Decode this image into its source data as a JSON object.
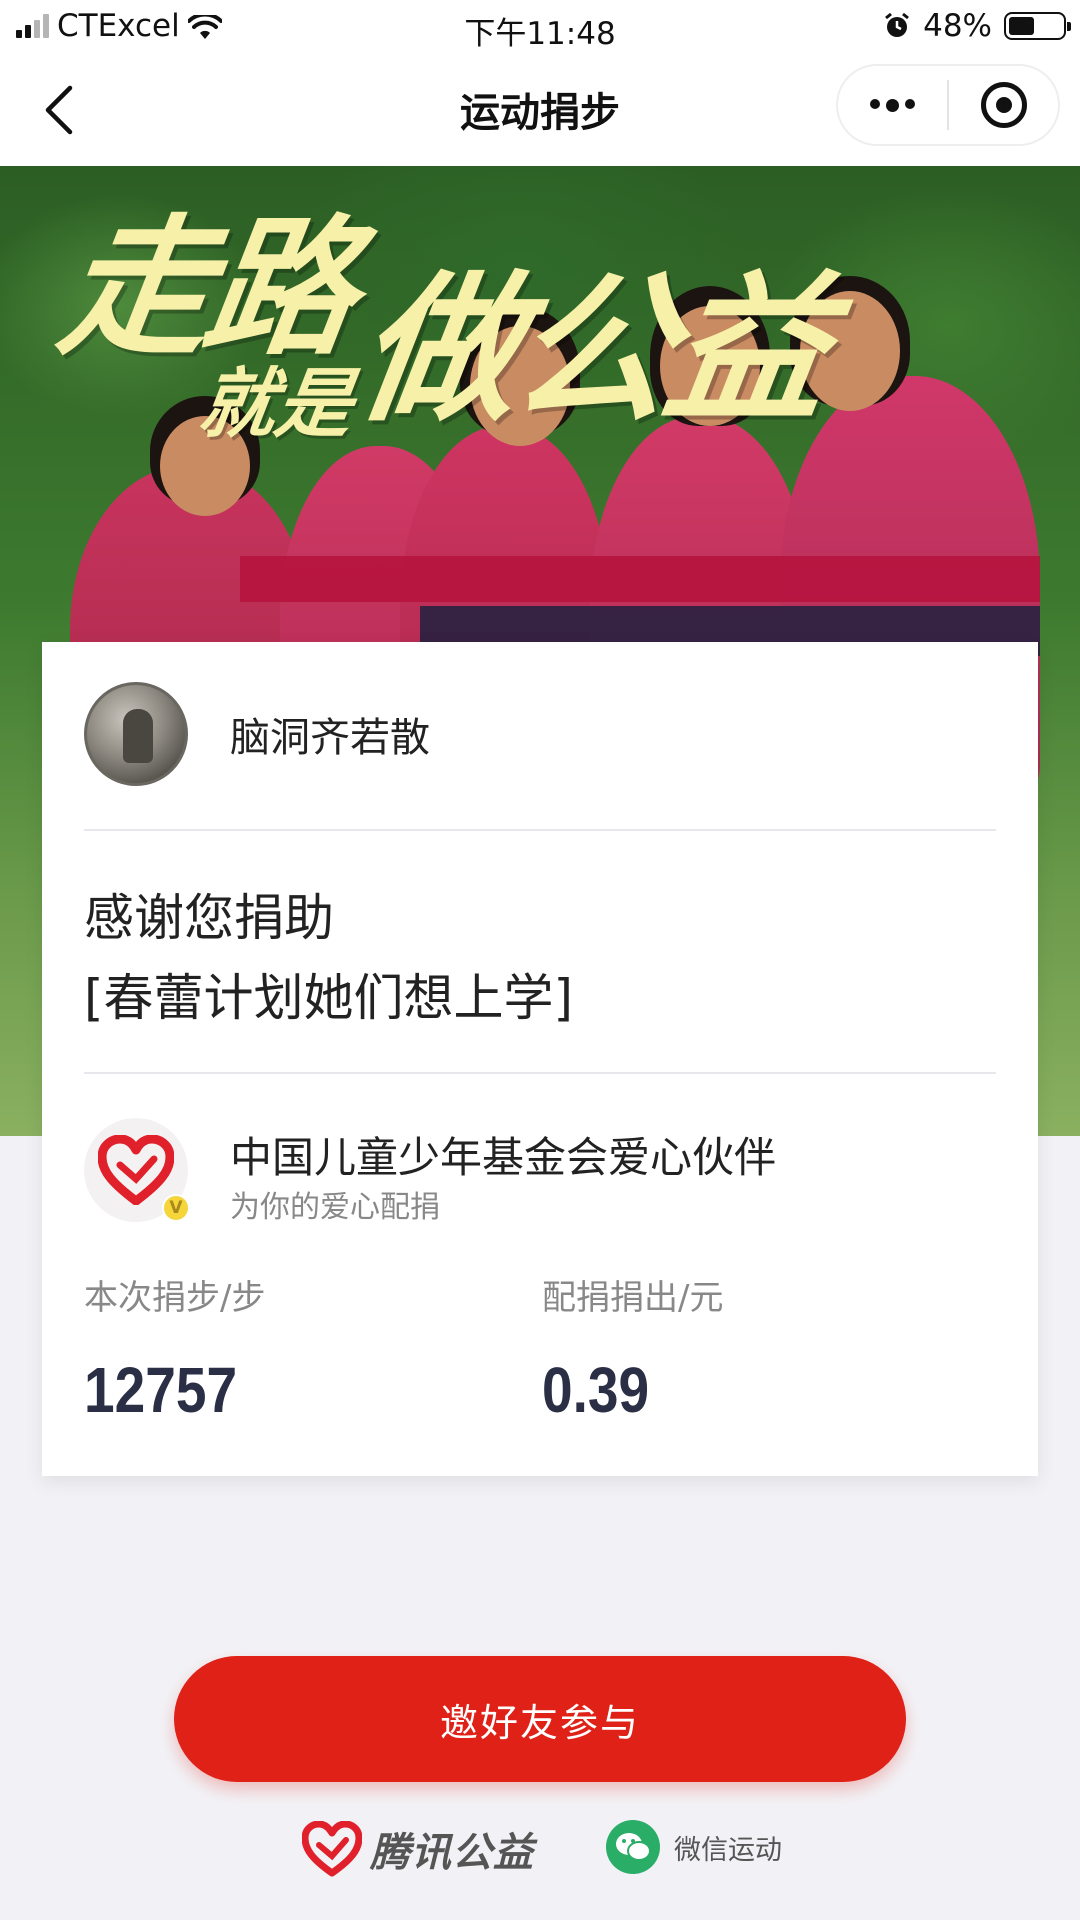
{
  "status_bar": {
    "carrier": "CTExcel",
    "time": "下午11:48",
    "battery_text": "48%",
    "battery_level": 0.48
  },
  "nav": {
    "title": "运动捐步"
  },
  "hero": {
    "line1": "走路",
    "line2": "就是",
    "line3": "做公益"
  },
  "card": {
    "user_name": "脑洞齐若散",
    "thanks_line1": "感谢您捐助",
    "thanks_line2": "[春蕾计划她们想上学]",
    "partner_name": "中国儿童少年基金会爱心伙伴",
    "partner_sub": "为你的爱心配捐",
    "partner_badge": "V",
    "stats": [
      {
        "label": "本次捐步/步",
        "value": "12757"
      },
      {
        "label": "配捐捐出/元",
        "value": "0.39"
      }
    ]
  },
  "actions": {
    "invite_label": "邀好友参与"
  },
  "footer": {
    "tencent_label": "腾讯公益",
    "wechat_label": "微信运动"
  },
  "colors": {
    "accent_red": "#e02117",
    "wechat_green": "#2aae67",
    "number_navy": "#2a2f45"
  }
}
